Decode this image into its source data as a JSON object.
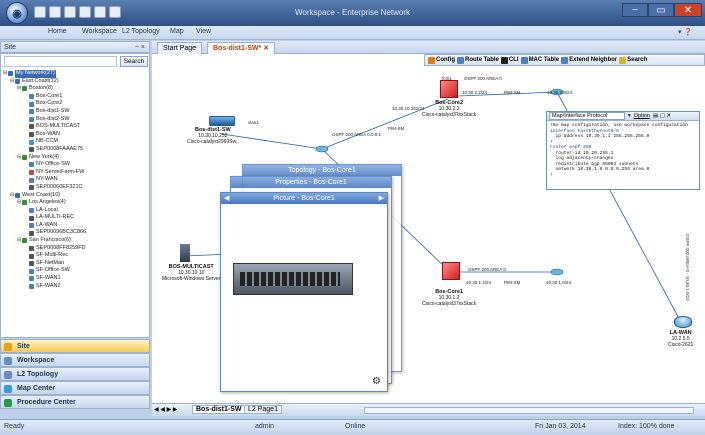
{
  "app": {
    "title": "Workspace - Enterprise Network",
    "menus": [
      "Home",
      "Workspace",
      "L2 Topology",
      "Map",
      "View"
    ]
  },
  "left_panel": {
    "title": "Site",
    "pin": "− ×",
    "search_label": "Search",
    "tree": [
      {
        "label": "My Network(27)",
        "level": 0,
        "color": "#2d6cc0",
        "selected": true
      },
      {
        "label": "East Coast(12)",
        "level": 1,
        "color": "#2d6cc0"
      },
      {
        "label": "Boston(8)",
        "level": 2,
        "color": "#3b8a3b"
      },
      {
        "label": "Bos-Core1",
        "level": 3,
        "color": "#4a7fc0"
      },
      {
        "label": "Bos-Core2",
        "level": 3,
        "color": "#4a7fc0"
      },
      {
        "label": "Bos-dist1-SW",
        "level": 3,
        "color": "#4a7fc0"
      },
      {
        "label": "Bos-dist2-SW",
        "level": 3,
        "color": "#4a7fc0"
      },
      {
        "label": "BOS-MULTICAST",
        "level": 3,
        "color": "#555"
      },
      {
        "label": "Bos-WAN",
        "level": 3,
        "color": "#555"
      },
      {
        "label": "NB-CCM",
        "level": 3,
        "color": "#3a9ad9"
      },
      {
        "label": "SEP0008FAAAE75",
        "level": 3,
        "color": "#555"
      },
      {
        "label": "New York(4)",
        "level": 2,
        "color": "#3b8a3b"
      },
      {
        "label": "NY-Office-SW",
        "level": 3,
        "color": "#4a7fc0"
      },
      {
        "label": "NY-ServerFarm-FW",
        "level": 3,
        "color": "#c04a4a"
      },
      {
        "label": "NY-WAN",
        "level": 3,
        "color": "#4a7fc0"
      },
      {
        "label": "SEP00060EF321C",
        "level": 3,
        "color": "#555"
      },
      {
        "label": "West Coast(10)",
        "level": 1,
        "color": "#2d6cc0"
      },
      {
        "label": "Los Angeles(4)",
        "level": 2,
        "color": "#3b8a3b"
      },
      {
        "label": "LA-Local",
        "level": 3,
        "color": "#4a7fc0"
      },
      {
        "label": "LA-MULTI-REC",
        "level": 3,
        "color": "#555"
      },
      {
        "label": "LA-WAN",
        "level": 3,
        "color": "#4a7fc0"
      },
      {
        "label": "SEP00096BC3C866",
        "level": 3,
        "color": "#555"
      },
      {
        "label": "San Francisco(6)",
        "level": 2,
        "color": "#3b8a3b"
      },
      {
        "label": "SEP0008FF8259FD",
        "level": 3,
        "color": "#555"
      },
      {
        "label": "SF-Multi-Rec",
        "level": 3,
        "color": "#555"
      },
      {
        "label": "SF-NetMan",
        "level": 3,
        "color": "#555"
      },
      {
        "label": "SF-Office-SW",
        "level": 3,
        "color": "#4a7fc0"
      },
      {
        "label": "SF-WAN1",
        "level": 3,
        "color": "#4a7fc0"
      },
      {
        "label": "SF-WAN2",
        "level": 3,
        "color": "#4a7fc0"
      }
    ]
  },
  "nav": [
    {
      "label": "Site",
      "active": true
    },
    {
      "label": "Workspace"
    },
    {
      "label": "L2 Topology"
    },
    {
      "label": "Map Center"
    },
    {
      "label": "Procedure Center"
    }
  ],
  "tabs": [
    {
      "label": "Start Page"
    },
    {
      "label": "Bos-dist1-SW*",
      "active": true
    }
  ],
  "toolbar": [
    "Config",
    "Route Table",
    "CLI",
    "MAC Table",
    "Extend Neighbor",
    "Search"
  ],
  "devices": {
    "dist1": {
      "name": "Bos-dist1-SW",
      "ip": "10.30.10.252",
      "model": "Cisco-catalyst2960Sw.."
    },
    "core2": {
      "name": "Bos-Core2",
      "ip": "10.30.2.2",
      "model": "Cisco-catalyst37xxStack"
    },
    "core1": {
      "name": "Bos-Core1",
      "ip": "10.30.1.2",
      "model": "Cisco-catalyst37xxStack"
    },
    "mcast": {
      "name": "BOS-MULTICAST",
      "ip": "10.30.10.10",
      "model": "Microsoft-Windows Server"
    },
    "lawan": {
      "name": "LA-WAN",
      "ip": "10.2.5.5",
      "model": "Cisco-2621"
    }
  },
  "link_labels": [
    "fi:0/1",
    "OSPF 200 AREA 0",
    "10.30.2.2/24",
    "PIM-SM",
    "10.30.2.0/24",
    "OSPF 200 AREA 0",
    "10.30.1.2/24",
    "PIM-SM",
    "10.30.1.0/24",
    "vlan1",
    "OSPF 200 AREA 0.0.0.1",
    "PIM-SM",
    "10.30.10.252/24"
  ],
  "popups": {
    "topology": "Topology - Bos-Core1",
    "properties": "Properties - Bos-Core1",
    "picture": "Picture - Bos-Core1"
  },
  "config": {
    "title": "Map\\Interface Protocol",
    "option": "Option",
    "lines": [
      "!No map configuration, use workspace configuration",
      "interface FastEthernet0/0",
      "  ip address 10.30.1.1 255.255.255.0",
      "!",
      "router ospf 200",
      "  router-id 10.20.255.1",
      "  log-adjacency-changes",
      "  redistribute bgp 65003 subnets",
      "  network 10.30.1.0 0.0.0.255 area 0",
      "!"
    ]
  },
  "bottom_tabs": [
    "Bos-dist1-SW",
    "L2 Page1"
  ],
  "status": {
    "left": "Ready",
    "user": "admin",
    "mode": "Online",
    "date": "Fri Jan 03, 2014",
    "index": "Index: 100% done"
  }
}
